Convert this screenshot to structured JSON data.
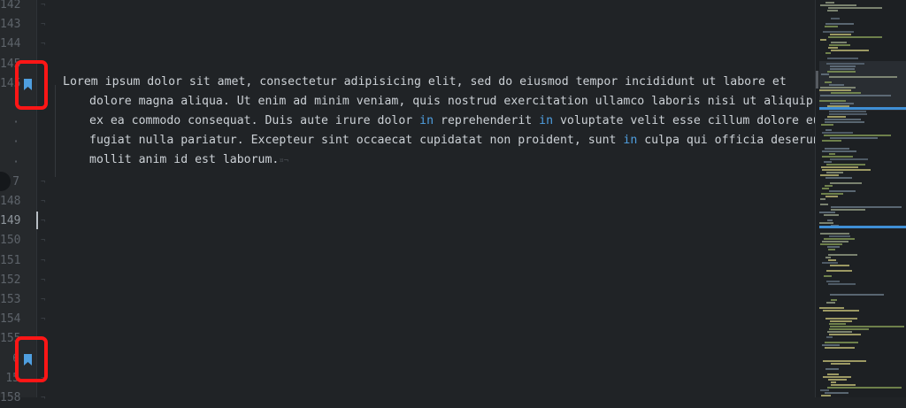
{
  "editor": {
    "gutter": {
      "lines": [
        {
          "label": "142"
        },
        {
          "label": "143"
        },
        {
          "label": "144"
        },
        {
          "label": "145"
        },
        {
          "label": "145",
          "bookmark": true
        },
        {
          "label": "·"
        },
        {
          "label": "·"
        },
        {
          "label": "·"
        },
        {
          "label": "·"
        },
        {
          "label": "7"
        },
        {
          "label": "148"
        },
        {
          "label": "149",
          "current": true
        },
        {
          "label": "150"
        },
        {
          "label": "151"
        },
        {
          "label": "152"
        },
        {
          "label": "153"
        },
        {
          "label": "154"
        },
        {
          "label": "155"
        },
        {
          "label": "6",
          "bookmark": true
        },
        {
          "label": "15"
        },
        {
          "label": "158"
        }
      ]
    },
    "paragraph": {
      "segments": [
        "Lorem ipsum dolor sit amet, consectetur adipisicing elit, sed do eiusmod tempor incididunt ut labore et dolore magna aliqua. Ut enim ad minim veniam, quis nostrud exercitation ullamco laboris nisi ut aliquip ex ea commodo consequat. Duis aute irure dolor ",
        "in",
        " reprehenderit ",
        "in",
        " voluptate velit esse cillum dolore eu fugiat nulla pariatur. Excepteur sint occaecat cupidatat non proident, sunt ",
        "in",
        " culpa qui officia deserunt mollit anim id est laborum."
      ],
      "end_of_line_marker": "¤¬",
      "keyword_color": "#4f9fe0"
    },
    "line_end_marker": "¬",
    "colors": {
      "background": "#202326",
      "gutter": "#26292c",
      "text": "#ccd1d6",
      "annotation": "#ff1616",
      "bookmark": "#4f9fe0"
    }
  }
}
